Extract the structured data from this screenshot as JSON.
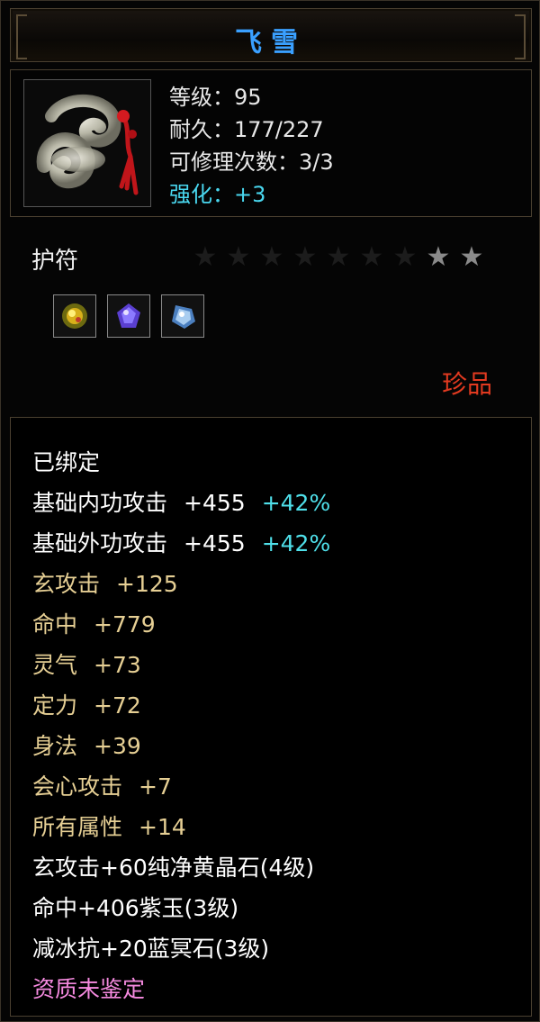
{
  "item": {
    "name": "飞雪",
    "stats": {
      "level": "等级：95",
      "durability": "耐久：177/227",
      "repair_count": "可修理次数：3/3",
      "enhance": "强化：+3"
    },
    "type": "护符",
    "stars": {
      "total": 9,
      "lit": 2
    },
    "gems": [
      "gold-gem-icon",
      "purple-gem-icon",
      "blue-crystal-icon"
    ],
    "rarity": "珍品"
  },
  "attributes": {
    "bound": "已绑定",
    "base_inner_attack": {
      "label": "基础内功攻击",
      "value": "+455",
      "bonus": "+42%"
    },
    "base_outer_attack": {
      "label": "基础外功攻击",
      "value": "+455",
      "bonus": "+42%"
    },
    "xuan_attack": {
      "label": "玄攻击",
      "value": "+125"
    },
    "hit": {
      "label": "命中",
      "value": "+779"
    },
    "spirit": {
      "label": "灵气",
      "value": "+73"
    },
    "focus": {
      "label": "定力",
      "value": "+72"
    },
    "agility": {
      "label": "身法",
      "value": "+39"
    },
    "crit_attack": {
      "label": "会心攻击",
      "value": "+7"
    },
    "all_attrs": {
      "label": "所有属性",
      "value": "+14"
    },
    "gem_line_1": "玄攻击+60纯净黄晶石(4级)",
    "gem_line_2": "命中+406紫玉(3级)",
    "gem_line_3": "减冰抗+20蓝冥石(3级)",
    "aptitude": "资质未鉴定"
  },
  "colors": {
    "title": "#3aa0ff",
    "enhance": "#49d7ef",
    "rarity": "#e23a20",
    "attribute_gold": "#e6cf94",
    "bonus_cyan": "#4fe0ea",
    "aptitude_pink": "#f58adf"
  }
}
